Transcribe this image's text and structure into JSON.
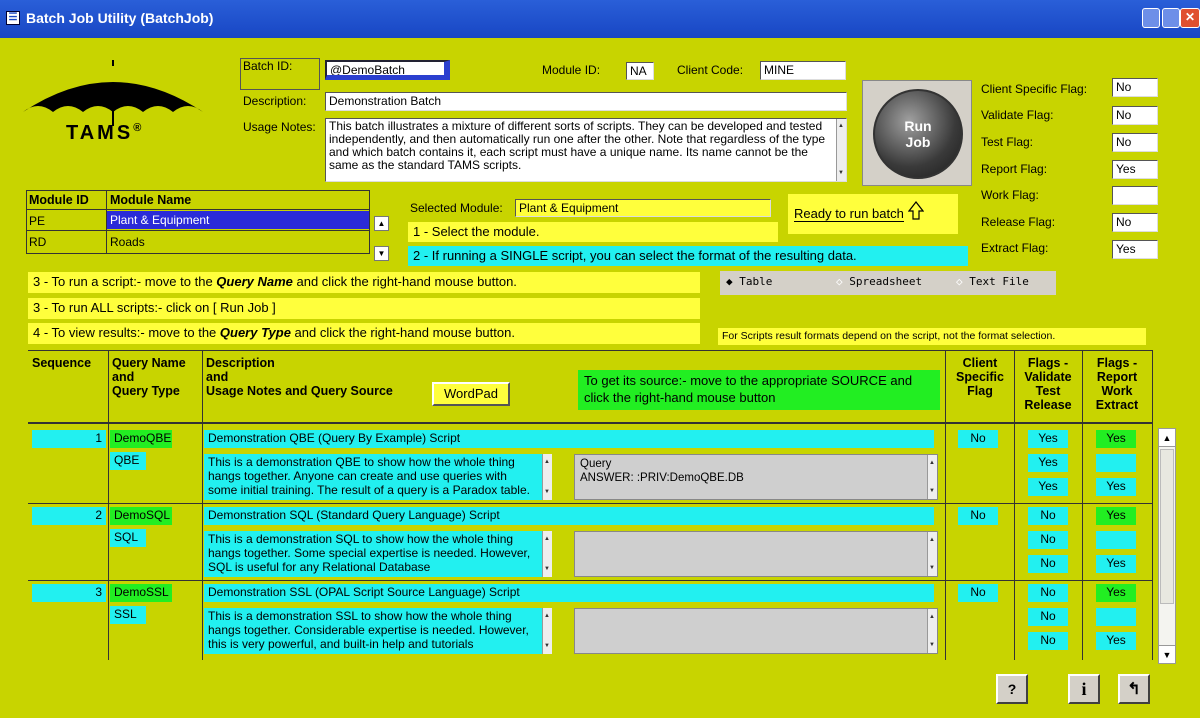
{
  "window": {
    "title": "Batch Job Utility (BatchJob)"
  },
  "logo": {
    "text": "TAMS",
    "mark": "®"
  },
  "batch": {
    "id_label": "Batch ID:",
    "id_value": "@DemoBatch",
    "module_label": "Module ID:",
    "module_value": "NA",
    "client_label": "Client Code:",
    "client_value": "MINE",
    "desc_label": "Description:",
    "desc_value": "Demonstration Batch",
    "notes_label": "Usage Notes:",
    "notes_value": "This batch illustrates a mixture of different sorts of scripts. They can be developed and tested independently, and then automatically run one after the other. Note that regardless of the type and which batch contains it, each script must have a  unique name. Its name cannot be the same as the standard TAMS scripts."
  },
  "run_button": {
    "line1": "Run",
    "line2": "Job"
  },
  "flags": [
    {
      "label": "Client Specific Flag:",
      "value": "No"
    },
    {
      "label": "Validate Flag:",
      "value": "No"
    },
    {
      "label": "Test Flag:",
      "value": "No"
    },
    {
      "label": "Report Flag:",
      "value": "Yes"
    },
    {
      "label": "Work Flag:",
      "value": ""
    },
    {
      "label": "Release Flag:",
      "value": "No"
    },
    {
      "label": "Extract Flag:",
      "value": "Yes"
    }
  ],
  "modules": {
    "col_id": "Module ID",
    "col_name": "Module Name",
    "rows": [
      {
        "id": "PE",
        "name": "Plant & Equipment"
      },
      {
        "id": "RD",
        "name": "Roads"
      }
    ]
  },
  "selected": {
    "label": "Selected Module:",
    "value": "Plant & Equipment"
  },
  "ready": "Ready to run batch",
  "steps": {
    "s1": "1 - Select the module.",
    "s2": "2 - If running a SINGLE script, you can select the format of the resulting data.",
    "s3a_pre": "3 - To run a script:- move to the ",
    "s3a_em": "Query Name",
    "s3a_post": " and click the right-hand mouse button.",
    "s3b": "3 - To run ALL scripts:- click on [ Run Job ]",
    "s4_pre": "4 - To view results:- move to the ",
    "s4_em": "Query Type",
    "s4_post": " and click the right-hand mouse button."
  },
  "formats": {
    "table": "Table",
    "spreadsheet": "Spreadsheet",
    "textfile": "Text File"
  },
  "scripts_note": "For Scripts result formats depend on the script, not the format selection.",
  "grid_headers": {
    "sequence": "Sequence",
    "qname": "Query Name",
    "and1": "and",
    "qtype": "Query Type",
    "desc": "Description",
    "and2": "and",
    "usage": "Usage Notes and Query Source",
    "wordpad": "WordPad",
    "source_hint": "To get its source:- move to the  appropriate SOURCE and click the right-hand mouse button",
    "client": "Client Specific Flag",
    "flags1_a": "Flags -",
    "flags1_b": "Validate",
    "flags1_c": "Test",
    "flags1_d": "Release",
    "flags2_a": "Flags -",
    "flags2_b": "Report",
    "flags2_c": "Work",
    "flags2_d": "Extract"
  },
  "rows": [
    {
      "seq": "1",
      "name": "DemoQBE",
      "type": "QBE",
      "desc": "Demonstration QBE (Query By Example) Script",
      "notes": "This is a demonstration QBE to show how the whole thing hangs together. Anyone can create and use queries with some initial training. The result of a query is a Paradox table.",
      "source1": "Query",
      "source2": "ANSWER: :PRIV:DemoQBE.DB",
      "client": "No",
      "validate": "Yes",
      "test": "Yes",
      "release": "Yes",
      "report": "Yes",
      "work": "",
      "extract": "Yes"
    },
    {
      "seq": "2",
      "name": "DemoSQL",
      "type": "SQL",
      "desc": "Demonstration SQL (Standard Query Language) Script",
      "notes": "This is a demonstration SQL to show how the whole thing hangs together. Some special expertise is needed. However, SQL is useful for any Relational Database",
      "source1": "",
      "source2": "",
      "client": "No",
      "validate": "No",
      "test": "No",
      "release": "No",
      "report": "Yes",
      "work": "",
      "extract": "Yes"
    },
    {
      "seq": "3",
      "name": "DemoSSL",
      "type": "SSL",
      "desc": "Demonstration SSL (OPAL Script Source Language) Script",
      "notes": "This is a demonstration SSL to show how the whole thing hangs together. Considerable expertise is needed. However, this is very powerful, and built-in help and tutorials",
      "source1": "",
      "source2": "",
      "client": "No",
      "validate": "No",
      "test": "No",
      "release": "No",
      "report": "Yes",
      "work": "",
      "extract": "Yes"
    }
  ],
  "bottom": {
    "help": "?",
    "info": "i",
    "exit": "↰"
  }
}
